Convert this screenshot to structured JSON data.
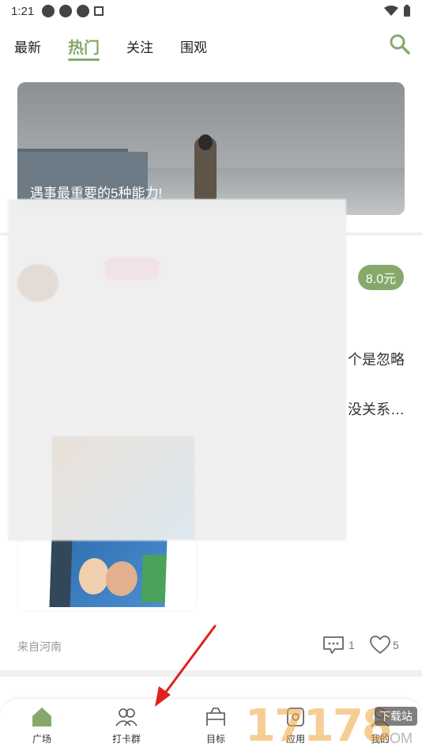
{
  "status_bar": {
    "time": "1:21"
  },
  "tabs": [
    {
      "label": "最新"
    },
    {
      "label": "热门",
      "active": true
    },
    {
      "label": "关注"
    },
    {
      "label": "围观"
    }
  ],
  "search": {
    "icon": "search-icon"
  },
  "banner": {
    "caption": "遇事最重要的5种能力!"
  },
  "post": {
    "price": "8.0元",
    "text_line1_fragment": "个是忽略",
    "text_line2_fragment": "没关系…",
    "location": "来自河南",
    "comment_count": "1",
    "like_count": "5"
  },
  "bottom_nav": [
    {
      "label": "广场",
      "icon": "home-icon",
      "active": true
    },
    {
      "label": "打卡群",
      "icon": "group-icon"
    },
    {
      "label": "目标",
      "icon": "target-icon"
    },
    {
      "label": "应用",
      "icon": "apps-icon"
    },
    {
      "label": "我的",
      "icon": "profile-icon"
    }
  ],
  "watermark": {
    "text": "17178",
    "badge": "下载站",
    "domain": ".COM"
  },
  "colors": {
    "accent": "#86a96b",
    "annotation_arrow": "#e02020"
  }
}
